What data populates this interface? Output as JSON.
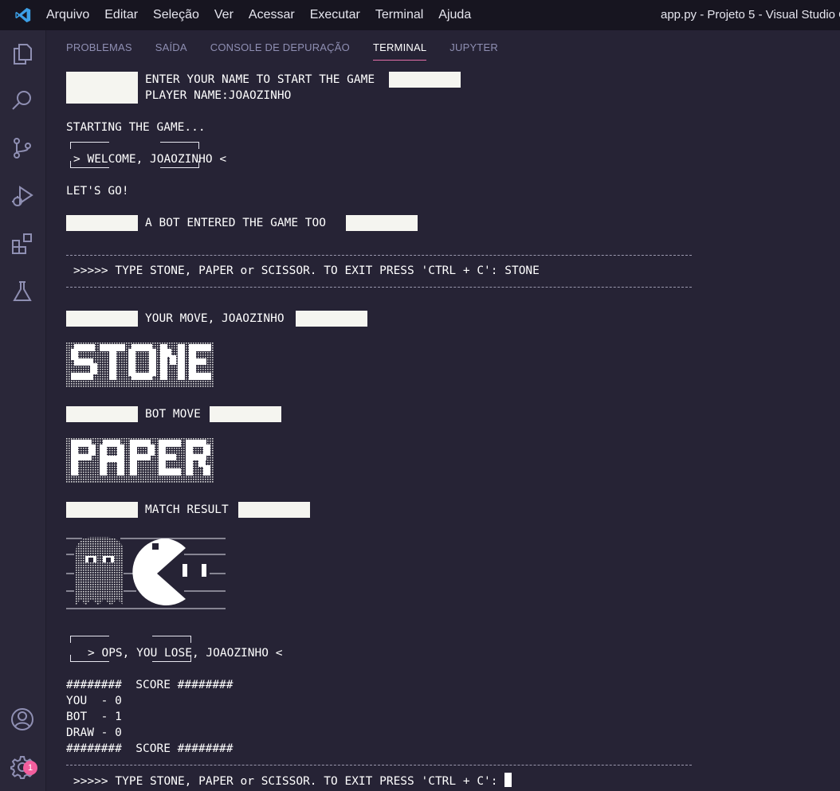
{
  "titlebar": {
    "menu": [
      "Arquivo",
      "Editar",
      "Seleção",
      "Ver",
      "Acessar",
      "Executar",
      "Terminal",
      "Ajuda"
    ],
    "window_title": "app.py - Projeto 5 - Visual Studio C"
  },
  "activitybar": {
    "icons": [
      "explorer-icon",
      "search-icon",
      "source-control-icon",
      "run-debug-icon",
      "extensions-icon",
      "testing-icon",
      "account-icon",
      "settings-gear-icon"
    ],
    "settings_badge": "1",
    "accent": "#f25e9d"
  },
  "panel": {
    "tabs": [
      "PROBLEMAS",
      "SAÍDA",
      "CONSOLE DE DEPURAÇÃO",
      "TERMINAL",
      "JUPYTER"
    ],
    "active_tab": "TERMINAL"
  },
  "terminal": {
    "enter_name": "ENTER YOUR NAME TO START THE GAME",
    "player_name": "PLAYER NAME:JOAOZINHO",
    "starting": "STARTING THE GAME...",
    "welcome": "> WELCOME, JOAOZINHO <",
    "lets_go": "LET'S GO!",
    "bot_entered": "A BOT ENTERED THE GAME TOO",
    "dashes": "--------------------------------------------------------------------------------",
    "prompt1": ">>>>> TYPE STONE, PAPER or SCISSOR. TO EXIT PRESS 'CTRL + C': STONE",
    "your_move": "YOUR MOVE, JOAOZINHO",
    "your_move_art": "STONE",
    "bot_move": "BOT MOVE",
    "bot_move_art": "PAPER",
    "match_result": "MATCH RESULT",
    "lose": "> OPS, YOU LOSE, JOAOZINHO <",
    "score_header": "########  SCORE ########",
    "score_you": "YOU  - 0",
    "score_bot": "BOT  - 1",
    "score_draw": "DRAW - 0",
    "score_footer": "########  SCORE ########",
    "prompt2": ">>>>> TYPE STONE, PAPER or SCISSOR. TO EXIT PRESS 'CTRL + C': "
  }
}
